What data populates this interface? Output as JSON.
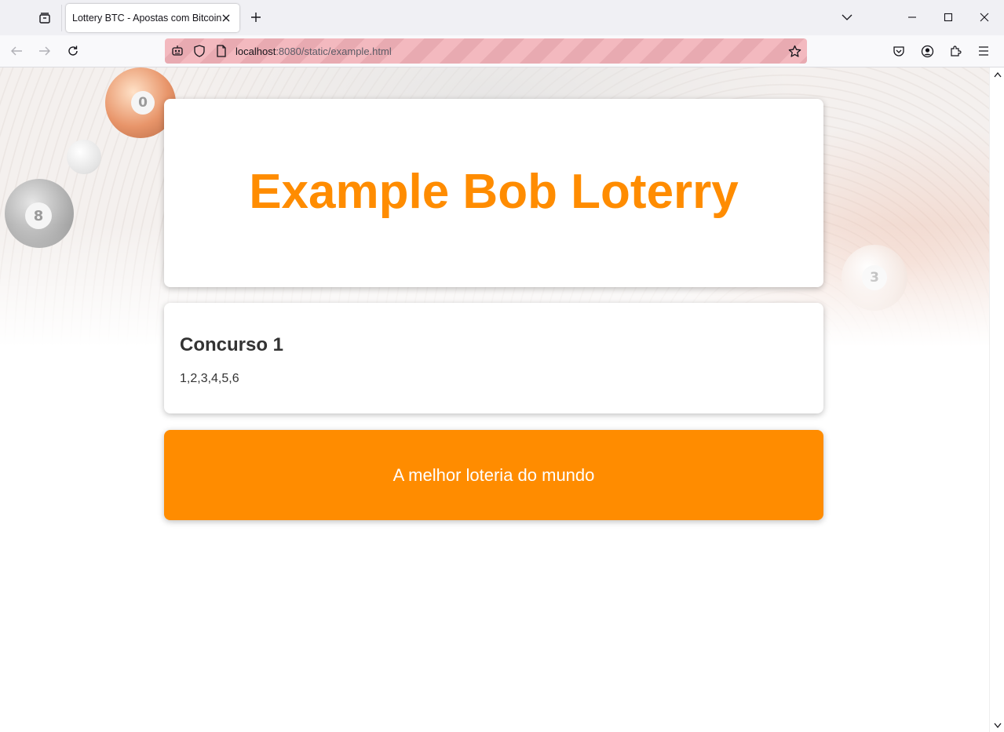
{
  "browser": {
    "tab_title": "Lottery BTC - Apostas com Bitcoin",
    "url_host": "localhost",
    "url_rest": ":8080/static/example.html"
  },
  "icons": {
    "list_all_tabs": "list-all-tabs-icon",
    "close_tab": "close-icon",
    "new_tab": "plus-icon",
    "dropdown": "chevron-down-icon",
    "minimize": "minimize-icon",
    "maximize": "maximize-icon",
    "close_window": "close-icon",
    "back": "back-arrow-icon",
    "forward": "forward-arrow-icon",
    "reload": "reload-icon",
    "remote_control": "robot-icon",
    "tracking_protection": "shield-icon",
    "page_info": "page-icon",
    "bookmark": "star-icon",
    "pocket": "pocket-icon",
    "account": "account-icon",
    "extensions": "puzzle-icon",
    "menu": "hamburger-menu-icon"
  },
  "page": {
    "header_title": "Example Bob Loterry",
    "contest": {
      "title": "Concurso 1",
      "numbers": "1,2,3,4,5,6"
    },
    "footer_text": "A melhor loteria do mundo",
    "decor_balls": [
      "0",
      "8",
      "3"
    ]
  },
  "colors": {
    "accent": "#ff8c00",
    "text_dark": "#333333",
    "card_bg": "#ffffff"
  }
}
